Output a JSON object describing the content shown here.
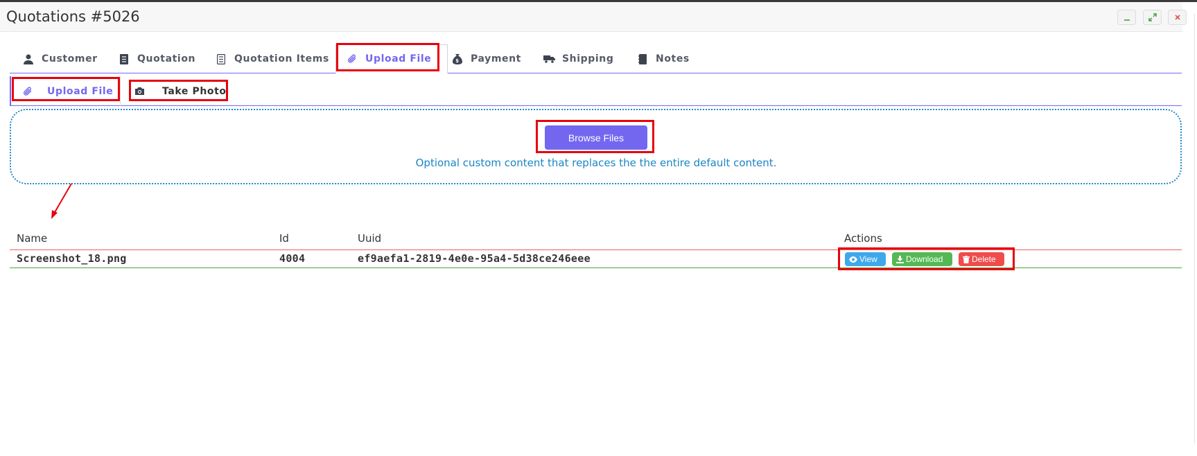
{
  "window": {
    "title": "Quotations #5026",
    "controls": [
      "minimize-icon",
      "expand-icon",
      "close-icon"
    ]
  },
  "tabs": [
    {
      "label": "Customer",
      "icon": "user-icon"
    },
    {
      "label": "Quotation",
      "icon": "document-icon"
    },
    {
      "label": "Quotation Items",
      "icon": "list-document-icon"
    },
    {
      "label": "Upload File",
      "icon": "paperclip-icon",
      "active": true
    },
    {
      "label": "Payment",
      "icon": "money-bag-icon"
    },
    {
      "label": "Shipping",
      "icon": "truck-icon"
    },
    {
      "label": "Notes",
      "icon": "notebook-icon"
    }
  ],
  "subtabs": [
    {
      "label": "Upload File",
      "icon": "paperclip-icon",
      "active": true
    },
    {
      "label": "Take Photo",
      "icon": "camera-icon"
    }
  ],
  "dropzone": {
    "button_label": "Browse Files",
    "text": "Optional custom content that replaces the the entire default content."
  },
  "table": {
    "headers": {
      "name": "Name",
      "id": "Id",
      "uuid": "Uuid",
      "actions": "Actions"
    },
    "rows": [
      {
        "name": "Screenshot_18.png",
        "id": "4004",
        "uuid": "ef9aefa1-2819-4e0e-95a4-5d38ce246eee"
      }
    ],
    "actions": {
      "view": "View",
      "download": "Download",
      "delete": "Delete"
    }
  },
  "colors": {
    "accent": "#7367f0",
    "annotation": "#e8000b",
    "info": "#3ea8eb",
    "success": "#55b855",
    "danger": "#ef4c4c",
    "link": "#1a86c4"
  }
}
